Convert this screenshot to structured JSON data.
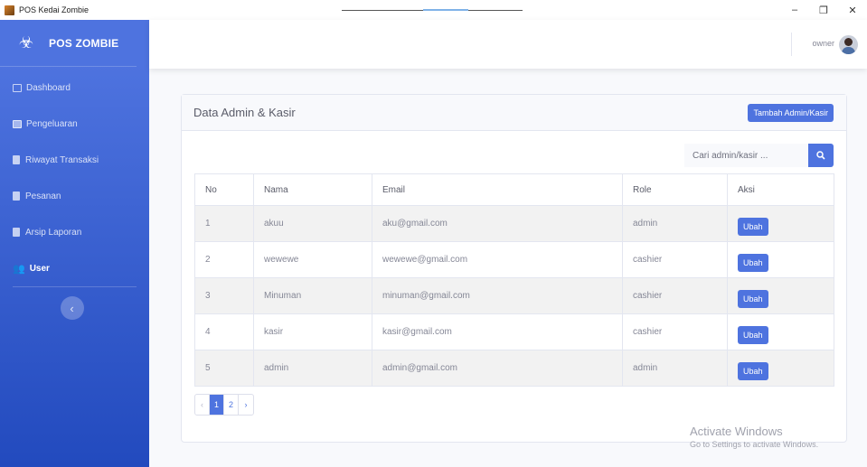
{
  "window": {
    "title": "POS Kedai Zombie",
    "controls": {
      "minimize": "–",
      "restore": "❐",
      "close": "✕"
    }
  },
  "sidebar": {
    "brand": "POS ZOMBIE",
    "items": [
      {
        "label": "Dashboard",
        "icon": "dashboard-icon"
      },
      {
        "label": "Pengeluaran",
        "icon": "wallet-icon"
      },
      {
        "label": "Riwayat Transaksi",
        "icon": "document-icon"
      },
      {
        "label": "Pesanan",
        "icon": "document-icon"
      },
      {
        "label": "Arsip Laporan",
        "icon": "document-icon"
      },
      {
        "label": "User",
        "icon": "users-icon",
        "active": true
      }
    ],
    "toggle_glyph": "‹"
  },
  "topbar": {
    "user_name": "owner"
  },
  "card": {
    "title": "Data Admin & Kasir",
    "add_button": "Tambah Admin/Kasir",
    "search_placeholder": "Cari admin/kasir ...",
    "columns": [
      "No",
      "Nama",
      "Email",
      "Role",
      "Aksi"
    ],
    "rows": [
      {
        "no": "1",
        "nama": "akuu",
        "email": "aku@gmail.com",
        "role": "admin",
        "action": "Ubah"
      },
      {
        "no": "2",
        "nama": "wewewe",
        "email": "wewewe@gmail.com",
        "role": "cashier",
        "action": "Ubah"
      },
      {
        "no": "3",
        "nama": "Minuman",
        "email": "minuman@gmail.com",
        "role": "cashier",
        "action": "Ubah"
      },
      {
        "no": "4",
        "nama": "kasir",
        "email": "kasir@gmail.com",
        "role": "cashier",
        "action": "Ubah"
      },
      {
        "no": "5",
        "nama": "admin",
        "email": "admin@gmail.com",
        "role": "admin",
        "action": "Ubah"
      }
    ],
    "pagination": {
      "prev": "‹",
      "pages": [
        "1",
        "2"
      ],
      "next": "›",
      "current": "1"
    }
  },
  "watermark": {
    "line1": "Activate Windows",
    "line2": "Go to Settings to activate Windows."
  },
  "colors": {
    "primary": "#4e73df",
    "sidebar_dark": "#224abe"
  }
}
